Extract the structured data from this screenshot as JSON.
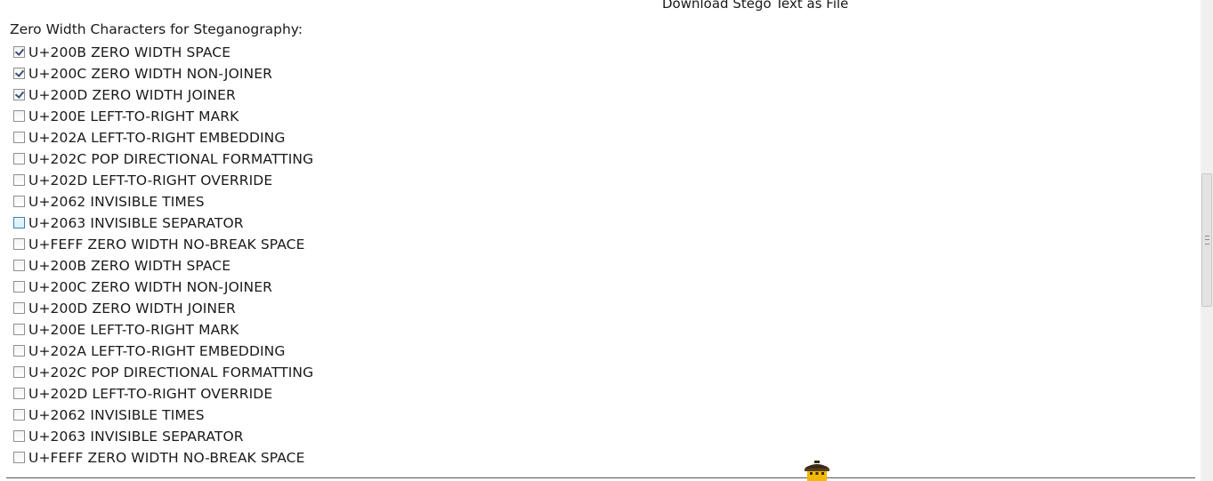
{
  "download_link": "Download Stego Text as File",
  "zw_section": {
    "title": "Zero Width Characters for Steganography:",
    "options": [
      {
        "label": "U+200B ZERO WIDTH SPACE",
        "checked": true
      },
      {
        "label": "U+200C ZERO WIDTH NON-JOINER",
        "checked": true
      },
      {
        "label": "U+200D ZERO WIDTH JOINER",
        "checked": true
      },
      {
        "label": "U+200E LEFT-TO-RIGHT MARK",
        "checked": false
      },
      {
        "label": "U+202A LEFT-TO-RIGHT EMBEDDING",
        "checked": false
      },
      {
        "label": "U+202C POP DIRECTIONAL FORMATTING",
        "checked": false
      },
      {
        "label": "U+202D LEFT-TO-RIGHT OVERRIDE",
        "checked": false
      },
      {
        "label": "U+2062 INVISIBLE TIMES",
        "checked": false
      },
      {
        "label": "U+2063 INVISIBLE SEPARATOR",
        "checked": false,
        "hovered": true
      },
      {
        "label": "U+FEFF ZERO WIDTH NO-BREAK SPACE",
        "checked": false
      },
      {
        "label": "U+200B ZERO WIDTH SPACE",
        "checked": false
      },
      {
        "label": "U+200C ZERO WIDTH NON-JOINER",
        "checked": false
      },
      {
        "label": "U+200D ZERO WIDTH JOINER",
        "checked": false
      },
      {
        "label": "U+200E LEFT-TO-RIGHT MARK",
        "checked": false
      },
      {
        "label": "U+202A LEFT-TO-RIGHT EMBEDDING",
        "checked": false
      },
      {
        "label": "U+202C POP DIRECTIONAL FORMATTING",
        "checked": false
      },
      {
        "label": "U+202D LEFT-TO-RIGHT OVERRIDE",
        "checked": false
      },
      {
        "label": "U+2062 INVISIBLE TIMES",
        "checked": false
      },
      {
        "label": "U+2063 INVISIBLE SEPARATOR",
        "checked": false
      },
      {
        "label": "U+FEFF ZERO WIDTH NO-BREAK SPACE",
        "checked": false
      }
    ]
  },
  "icons": {
    "footer_icon": "lantern-icon",
    "scroll_grip": "scroll-grip-icon"
  },
  "colors": {
    "checkmark": "#3c4f73",
    "hover_border": "#3c7fb1",
    "lantern_body": "#f2b705"
  }
}
